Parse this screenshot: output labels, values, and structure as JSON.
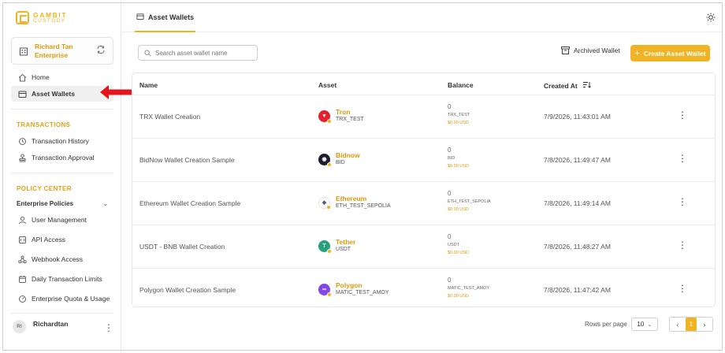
{
  "brand": {
    "line1": "GAMBIT",
    "line2": "CUSTODY",
    "accent": "#f0b323"
  },
  "org": {
    "name": "Richard Tan Enterprise"
  },
  "nav": {
    "home": "Home",
    "asset_wallets": "Asset Wallets",
    "transactions_title": "TRANSACTIONS",
    "transaction_history": "Transaction History",
    "transaction_approval": "Transaction Approval",
    "policy_title": "POLICY CENTER",
    "enterprise_policies": "Enterprise Policies",
    "user_management": "User Management",
    "api_access": "API Access",
    "webhook_access": "Webhook Access",
    "daily_limits": "Daily Transaction Limits",
    "quota_usage": "Enterprise Quota & Usage"
  },
  "user": {
    "initials": "RI",
    "name": "Richardtan"
  },
  "header": {
    "tab_label": "Asset Wallets"
  },
  "toolbar": {
    "search_placeholder": "Search asset wallet name",
    "archived_label": "Archived Wallet",
    "create_label": "Create Asset Wallet"
  },
  "table": {
    "headers": {
      "name": "Name",
      "asset": "Asset",
      "balance": "Balance",
      "created": "Created At"
    },
    "rows": [
      {
        "name": "TRX Wallet Creation",
        "asset": "Tron",
        "symbol": "TRX_TEST",
        "coin_color": "#e5202a",
        "coin_glyph": "▼",
        "balance": "0",
        "balance_symbol": "TRX_TEST",
        "balance_usd": "$0.00 USD",
        "created": "7/9/2026, 11:43:01 AM"
      },
      {
        "name": "BidNow Wallet Creation Sample",
        "asset": "Bidnow",
        "symbol": "BID",
        "coin_color": "#1c1c2e",
        "coin_glyph": "◉",
        "balance": "0",
        "balance_symbol": "BID",
        "balance_usd": "$0.00 USD",
        "created": "7/8/2026, 11:49:47 AM"
      },
      {
        "name": "Ethereum Wallet Creation Sample",
        "asset": "Ethereum",
        "symbol": "ETH_TEST_SEPOLIA",
        "coin_color": "#ffffff",
        "coin_glyph": "◆",
        "balance": "0",
        "balance_symbol": "ETH_TEST_SEPOLIA",
        "balance_usd": "$0.00 USD",
        "created": "7/8/2026, 11:49:14 AM"
      },
      {
        "name": "USDT - BNB Wallet Creation",
        "asset": "Tether",
        "symbol": "USDT",
        "coin_color": "#26a17b",
        "coin_glyph": "T",
        "balance": "0",
        "balance_symbol": "USDT",
        "balance_usd": "$0.00 USD",
        "created": "7/8/2026, 11:48:27 AM"
      },
      {
        "name": "Polygon Wallet Creation Sample",
        "asset": "Polygon",
        "symbol": "MATIC_TEST_AMOY",
        "coin_color": "#8247e5",
        "coin_glyph": "∞",
        "balance": "0",
        "balance_symbol": "MATIC_TEST_AMOY",
        "balance_usd": "$0.00 USD",
        "created": "7/8/2026, 11:47:42 AM"
      }
    ]
  },
  "pagination": {
    "rows_label": "Rows per page",
    "rows_value": "10",
    "current_page": "1"
  }
}
